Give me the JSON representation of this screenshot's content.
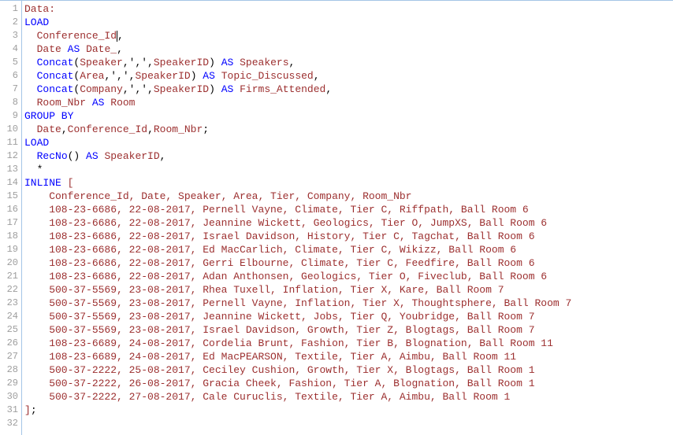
{
  "lines": [
    {
      "num": 1,
      "segments": [
        {
          "cls": "data",
          "text": "Data:"
        }
      ]
    },
    {
      "num": 2,
      "segments": [
        {
          "cls": "kw",
          "text": "LOAD"
        }
      ]
    },
    {
      "num": 3,
      "segments": [
        {
          "cls": "plain",
          "text": "  "
        },
        {
          "cls": "ident",
          "text": "Conference_Id"
        },
        {
          "cls": "cursor",
          "text": ""
        },
        {
          "cls": "plain",
          "text": ","
        }
      ]
    },
    {
      "num": 4,
      "segments": [
        {
          "cls": "plain",
          "text": "  "
        },
        {
          "cls": "ident",
          "text": "Date"
        },
        {
          "cls": "plain",
          "text": " "
        },
        {
          "cls": "kw",
          "text": "AS"
        },
        {
          "cls": "plain",
          "text": " "
        },
        {
          "cls": "ident",
          "text": "Date_"
        },
        {
          "cls": "plain",
          "text": ","
        }
      ]
    },
    {
      "num": 5,
      "segments": [
        {
          "cls": "plain",
          "text": "  "
        },
        {
          "cls": "fn",
          "text": "Concat"
        },
        {
          "cls": "plain",
          "text": "("
        },
        {
          "cls": "ident",
          "text": "Speaker"
        },
        {
          "cls": "plain",
          "text": ",',',"
        },
        {
          "cls": "ident",
          "text": "SpeakerID"
        },
        {
          "cls": "plain",
          "text": ") "
        },
        {
          "cls": "kw",
          "text": "AS"
        },
        {
          "cls": "plain",
          "text": " "
        },
        {
          "cls": "ident",
          "text": "Speakers"
        },
        {
          "cls": "plain",
          "text": ","
        }
      ]
    },
    {
      "num": 6,
      "segments": [
        {
          "cls": "plain",
          "text": "  "
        },
        {
          "cls": "fn",
          "text": "Concat"
        },
        {
          "cls": "plain",
          "text": "("
        },
        {
          "cls": "ident",
          "text": "Area"
        },
        {
          "cls": "plain",
          "text": ",',',"
        },
        {
          "cls": "ident",
          "text": "SpeakerID"
        },
        {
          "cls": "plain",
          "text": ") "
        },
        {
          "cls": "kw",
          "text": "AS"
        },
        {
          "cls": "plain",
          "text": " "
        },
        {
          "cls": "ident",
          "text": "Topic_Discussed"
        },
        {
          "cls": "plain",
          "text": ","
        }
      ]
    },
    {
      "num": 7,
      "segments": [
        {
          "cls": "plain",
          "text": "  "
        },
        {
          "cls": "fn",
          "text": "Concat"
        },
        {
          "cls": "plain",
          "text": "("
        },
        {
          "cls": "ident",
          "text": "Company"
        },
        {
          "cls": "plain",
          "text": ",',',"
        },
        {
          "cls": "ident",
          "text": "SpeakerID"
        },
        {
          "cls": "plain",
          "text": ") "
        },
        {
          "cls": "kw",
          "text": "AS"
        },
        {
          "cls": "plain",
          "text": " "
        },
        {
          "cls": "ident",
          "text": "Firms_Attended"
        },
        {
          "cls": "plain",
          "text": ","
        }
      ]
    },
    {
      "num": 8,
      "segments": [
        {
          "cls": "plain",
          "text": "  "
        },
        {
          "cls": "ident",
          "text": "Room_Nbr"
        },
        {
          "cls": "plain",
          "text": " "
        },
        {
          "cls": "kw",
          "text": "AS"
        },
        {
          "cls": "plain",
          "text": " "
        },
        {
          "cls": "ident",
          "text": "Room"
        }
      ]
    },
    {
      "num": 9,
      "segments": [
        {
          "cls": "kw",
          "text": "GROUP BY"
        }
      ]
    },
    {
      "num": 10,
      "segments": [
        {
          "cls": "plain",
          "text": "  "
        },
        {
          "cls": "ident",
          "text": "Date"
        },
        {
          "cls": "plain",
          "text": ","
        },
        {
          "cls": "ident",
          "text": "Conference_Id"
        },
        {
          "cls": "plain",
          "text": ","
        },
        {
          "cls": "ident",
          "text": "Room_Nbr"
        },
        {
          "cls": "plain",
          "text": ";"
        }
      ]
    },
    {
      "num": 11,
      "segments": [
        {
          "cls": "kw",
          "text": "LOAD"
        }
      ]
    },
    {
      "num": 12,
      "segments": [
        {
          "cls": "plain",
          "text": "  "
        },
        {
          "cls": "fn",
          "text": "RecNo"
        },
        {
          "cls": "plain",
          "text": "() "
        },
        {
          "cls": "kw",
          "text": "AS"
        },
        {
          "cls": "plain",
          "text": " "
        },
        {
          "cls": "ident",
          "text": "SpeakerID"
        },
        {
          "cls": "plain",
          "text": ","
        }
      ]
    },
    {
      "num": 13,
      "segments": [
        {
          "cls": "plain",
          "text": "  *"
        }
      ]
    },
    {
      "num": 14,
      "segments": [
        {
          "cls": "kw",
          "text": "INLINE"
        },
        {
          "cls": "plain",
          "text": " "
        },
        {
          "cls": "ident",
          "text": "["
        }
      ]
    },
    {
      "num": 15,
      "segments": [
        {
          "cls": "ident",
          "text": "    Conference_Id, Date, Speaker, Area, Tier, Company, Room_Nbr"
        }
      ]
    },
    {
      "num": 16,
      "segments": [
        {
          "cls": "ident",
          "text": "    108-23-6686, 22-08-2017, Pernell Vayne, Climate, Tier C, Riffpath, Ball Room 6"
        }
      ]
    },
    {
      "num": 17,
      "segments": [
        {
          "cls": "ident",
          "text": "    108-23-6686, 22-08-2017, Jeannine Wickett, Geologics, Tier O, JumpXS, Ball Room 6"
        }
      ]
    },
    {
      "num": 18,
      "segments": [
        {
          "cls": "ident",
          "text": "    108-23-6686, 22-08-2017, Israel Davidson, History, Tier C, Tagchat, Ball Room 6"
        }
      ]
    },
    {
      "num": 19,
      "segments": [
        {
          "cls": "ident",
          "text": "    108-23-6686, 22-08-2017, Ed MacCarlich, Climate, Tier C, Wikizz, Ball Room 6"
        }
      ]
    },
    {
      "num": 20,
      "segments": [
        {
          "cls": "ident",
          "text": "    108-23-6686, 22-08-2017, Gerri Elbourne, Climate, Tier C, Feedfire, Ball Room 6"
        }
      ]
    },
    {
      "num": 21,
      "segments": [
        {
          "cls": "ident",
          "text": "    108-23-6686, 22-08-2017, Adan Anthonsen, Geologics, Tier O, Fiveclub, Ball Room 6"
        }
      ]
    },
    {
      "num": 22,
      "segments": [
        {
          "cls": "ident",
          "text": "    500-37-5569, 23-08-2017, Rhea Tuxell, Inflation, Tier X, Kare, Ball Room 7"
        }
      ]
    },
    {
      "num": 23,
      "segments": [
        {
          "cls": "ident",
          "text": "    500-37-5569, 23-08-2017, Pernell Vayne, Inflation, Tier X, Thoughtsphere, Ball Room 7"
        }
      ]
    },
    {
      "num": 24,
      "segments": [
        {
          "cls": "ident",
          "text": "    500-37-5569, 23-08-2017, Jeannine Wickett, Jobs, Tier Q, Youbridge, Ball Room 7"
        }
      ]
    },
    {
      "num": 25,
      "segments": [
        {
          "cls": "ident",
          "text": "    500-37-5569, 23-08-2017, Israel Davidson, Growth, Tier Z, Blogtags, Ball Room 7"
        }
      ]
    },
    {
      "num": 26,
      "segments": [
        {
          "cls": "ident",
          "text": "    108-23-6689, 24-08-2017, Cordelia Brunt, Fashion, Tier B, Blognation, Ball Room 11"
        }
      ]
    },
    {
      "num": 27,
      "segments": [
        {
          "cls": "ident",
          "text": "    108-23-6689, 24-08-2017, Ed MacPEARSON, Textile, Tier A, Aimbu, Ball Room 11"
        }
      ]
    },
    {
      "num": 28,
      "segments": [
        {
          "cls": "ident",
          "text": "    500-37-2222, 25-08-2017, Ceciley Cushion, Growth, Tier X, Blogtags, Ball Room 1"
        }
      ]
    },
    {
      "num": 29,
      "segments": [
        {
          "cls": "ident",
          "text": "    500-37-2222, 26-08-2017, Gracia Cheek, Fashion, Tier A, Blognation, Ball Room 1"
        }
      ]
    },
    {
      "num": 30,
      "segments": [
        {
          "cls": "ident",
          "text": "    500-37-2222, 27-08-2017, Cale Curuclis, Textile, Tier A, Aimbu, Ball Room 1"
        }
      ]
    },
    {
      "num": 31,
      "segments": [
        {
          "cls": "ident",
          "text": "]"
        },
        {
          "cls": "plain",
          "text": ";"
        }
      ]
    },
    {
      "num": 32,
      "segments": [
        {
          "cls": "plain",
          "text": ""
        }
      ]
    }
  ]
}
